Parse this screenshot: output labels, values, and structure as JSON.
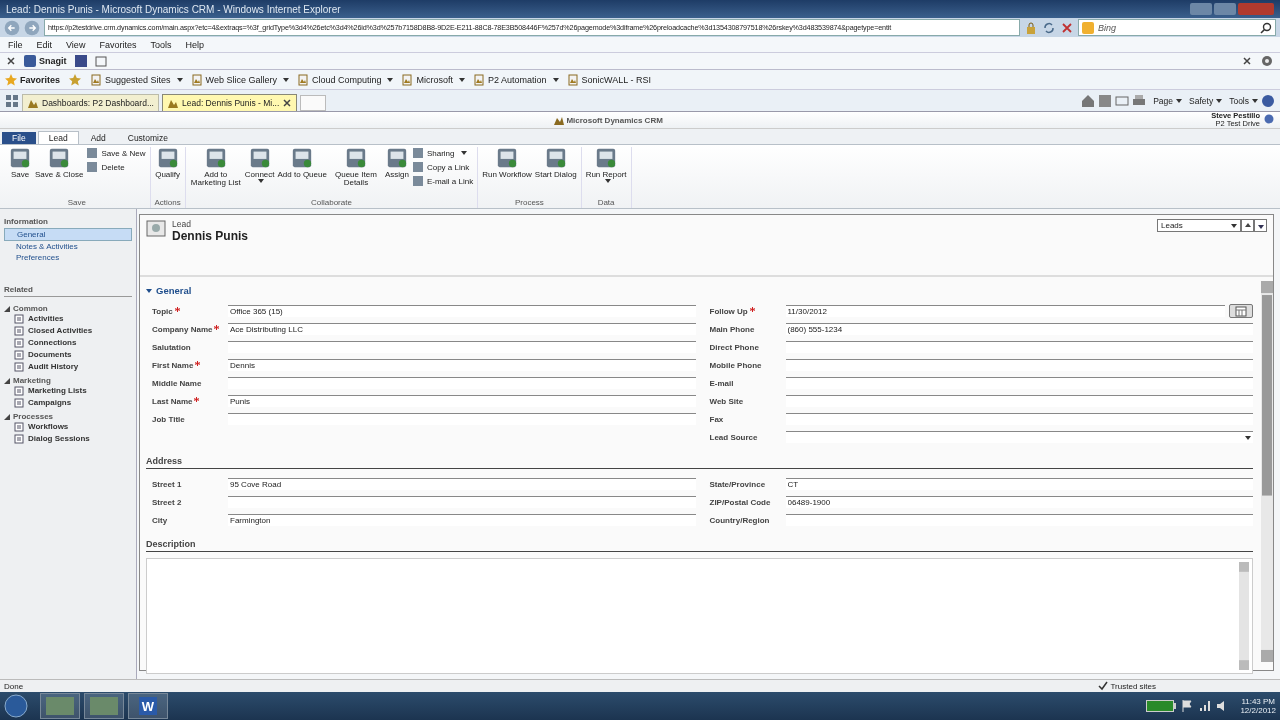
{
  "window": {
    "title": "Lead: Dennis Punis - Microsoft Dynamics CRM - Windows Internet Explorer"
  },
  "address_bar": {
    "url": "https://p2testdrive.crm.dynamics.com/main.aspx?etc=4&extraqs=%3f_gridType%3d4%26etc%3d4%26id%3d%257b7158D8B8-9D2E-E211-88C8-78E3B508446F%257d%26pagemode%3diframe%26preloadcache%3d1354308797518%26rskey%3d483539874&pagetype=entit",
    "search_placeholder": "Bing"
  },
  "menu_bar": [
    "File",
    "Edit",
    "View",
    "Favorites",
    "Tools",
    "Help"
  ],
  "toolbar": {
    "label": "Snagit"
  },
  "favorites_bar": [
    {
      "label": "Favorites",
      "kind": "favorites",
      "dropdown": false
    },
    {
      "label": "Suggested Sites",
      "kind": "site",
      "dropdown": true
    },
    {
      "label": "Web Slice Gallery",
      "kind": "site",
      "dropdown": true
    },
    {
      "label": "Cloud Computing",
      "kind": "site",
      "dropdown": true
    },
    {
      "label": "Microsoft",
      "kind": "site",
      "dropdown": true
    },
    {
      "label": "P2 Automation",
      "kind": "site",
      "dropdown": true
    },
    {
      "label": "SonicWALL - RSI",
      "kind": "site",
      "dropdown": false
    }
  ],
  "browser_tabs": [
    {
      "label": "Dashboards: P2 Dashboard...",
      "selected": false
    },
    {
      "label": "Lead: Dennis Punis - Mi...",
      "selected": true
    }
  ],
  "command_bar": [
    "Page",
    "Safety",
    "Tools"
  ],
  "crm_header": {
    "product": "Microsoft Dynamics CRM",
    "user": "Steve Pestillo",
    "organization": "P2 Test Drive"
  },
  "ribbon_tabs": [
    {
      "label": "File",
      "kind": "file",
      "selected": false
    },
    {
      "label": "Lead",
      "kind": "tab",
      "selected": true
    },
    {
      "label": "Add",
      "kind": "tab",
      "selected": false
    },
    {
      "label": "Customize",
      "kind": "tab",
      "selected": false
    }
  ],
  "ribbon_groups": [
    {
      "name": "Save",
      "buttons": [
        {
          "label": "Save",
          "kind": "large",
          "dropdown": false
        },
        {
          "label": "Save & Close",
          "kind": "large",
          "dropdown": false
        },
        {
          "label": "Save & New",
          "kind": "small",
          "dropdown": false
        },
        {
          "label": "Delete",
          "kind": "small",
          "dropdown": false
        }
      ]
    },
    {
      "name": "Actions",
      "buttons": [
        {
          "label": "Qualify",
          "kind": "large",
          "dropdown": false
        }
      ]
    },
    {
      "name": "Collaborate",
      "buttons": [
        {
          "label": "Add to Marketing List",
          "kind": "large",
          "dropdown": false
        },
        {
          "label": "Connect",
          "kind": "large",
          "dropdown": true
        },
        {
          "label": "Add to Queue",
          "kind": "large",
          "dropdown": false
        },
        {
          "label": "Queue Item Details",
          "kind": "large",
          "dropdown": false
        },
        {
          "label": "Assign",
          "kind": "large",
          "dropdown": false
        },
        {
          "label": "Sharing",
          "kind": "small",
          "dropdown": true
        },
        {
          "label": "Copy a Link",
          "kind": "small",
          "dropdown": false
        },
        {
          "label": "E-mail a Link",
          "kind": "small",
          "dropdown": false
        }
      ]
    },
    {
      "name": "Process",
      "buttons": [
        {
          "label": "Run Workflow",
          "kind": "large",
          "dropdown": false
        },
        {
          "label": "Start Dialog",
          "kind": "large",
          "dropdown": false
        }
      ]
    },
    {
      "name": "Data",
      "buttons": [
        {
          "label": "Run Report",
          "kind": "large",
          "dropdown": true
        }
      ]
    }
  ],
  "nav": {
    "information": {
      "title": "Information",
      "items": [
        {
          "label": "General",
          "selected": true
        },
        {
          "label": "Notes & Activities",
          "selected": false
        },
        {
          "label": "Preferences",
          "selected": false
        }
      ]
    },
    "related": {
      "title": "Related",
      "groups": [
        {
          "title": "Common",
          "expanded": true,
          "items": [
            "Activities",
            "Closed Activities",
            "Connections",
            "Documents",
            "Audit History"
          ]
        },
        {
          "title": "Marketing",
          "expanded": true,
          "items": [
            "Marketing Lists",
            "Campaigns"
          ]
        },
        {
          "title": "Processes",
          "expanded": true,
          "items": [
            "Workflows",
            "Dialog Sessions"
          ]
        }
      ]
    }
  },
  "form": {
    "entity": "Lead",
    "name": "Dennis Punis",
    "view_selector": "Leads",
    "section": "General",
    "fields_left": [
      {
        "label": "Topic",
        "required": true,
        "kind": "text",
        "value": "Office 365 (15)"
      },
      {
        "label": "Company Name",
        "required": true,
        "kind": "text",
        "value": "Ace Distributing LLC"
      },
      {
        "label": "Salutation",
        "required": false,
        "kind": "text"
      },
      {
        "label": "First Name",
        "required": true,
        "kind": "text",
        "value": "Dennis"
      },
      {
        "label": "Middle Name",
        "required": false,
        "kind": "text"
      },
      {
        "label": "Last Name",
        "required": true,
        "kind": "text",
        "value": "Punis"
      },
      {
        "label": "Job Title",
        "required": false,
        "kind": "text"
      }
    ],
    "fields_right": [
      {
        "label": "Follow Up",
        "required": true,
        "kind": "date",
        "value": "11/30/2012"
      },
      {
        "label": "Main Phone",
        "required": false,
        "kind": "text",
        "value": "(860) 555-1234"
      },
      {
        "label": "Direct Phone",
        "required": false,
        "kind": "text"
      },
      {
        "label": "Mobile Phone",
        "required": false,
        "kind": "text"
      },
      {
        "label": "E-mail",
        "required": false,
        "kind": "text"
      },
      {
        "label": "Web Site",
        "required": false,
        "kind": "text"
      },
      {
        "label": "Fax",
        "required": false,
        "kind": "text"
      },
      {
        "label": "Lead Source",
        "required": false,
        "kind": "select"
      }
    ],
    "address_title": "Address",
    "address_left": [
      {
        "label": "Street 1",
        "required": false,
        "kind": "text",
        "value": "95 Cove Road"
      },
      {
        "label": "Street 2",
        "required": false,
        "kind": "text"
      },
      {
        "label": "City",
        "required": false,
        "kind": "text",
        "value": "Farmington"
      }
    ],
    "address_right": [
      {
        "label": "State/Province",
        "required": false,
        "kind": "text",
        "value": "CT"
      },
      {
        "label": "ZIP/Postal Code",
        "required": false,
        "kind": "text",
        "value": "06489-1900"
      },
      {
        "label": "Country/Region",
        "required": false,
        "kind": "text"
      }
    ],
    "description_title": "Description"
  },
  "status_bar": {
    "text": "Done",
    "zone": "Trusted sites"
  },
  "taskbar": {
    "apps": [
      {
        "kind": "thumbnail"
      },
      {
        "kind": "thumbnail"
      },
      {
        "kind": "word",
        "label": "W"
      }
    ],
    "time": "11:43 PM",
    "date": "12/2/2012"
  }
}
